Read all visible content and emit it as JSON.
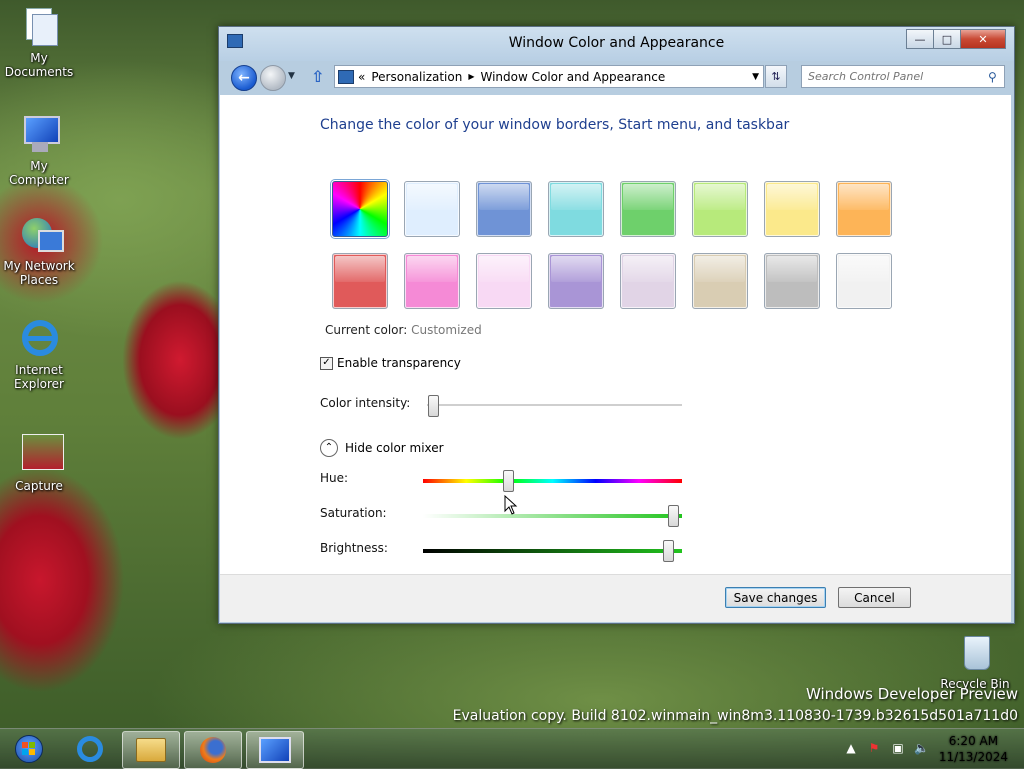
{
  "desktop": {
    "icons": [
      {
        "label": "My Documents"
      },
      {
        "label": "My Computer"
      },
      {
        "label": "My Network Places"
      },
      {
        "label": "Internet Explorer"
      },
      {
        "label": "Capture"
      },
      {
        "label": "Recycle Bin"
      }
    ],
    "watermark_line1": "Windows Developer Preview",
    "watermark_line2": "Evaluation copy. Build 8102.winmain_win8m3.110830-1739.b32615d501a711d0"
  },
  "window": {
    "title": "Window Color and Appearance",
    "caption_buttons": {
      "minimize": "—",
      "maximize": "□",
      "close": "✕"
    },
    "breadcrumb": [
      "Personalization",
      "Window Color and Appearance"
    ],
    "breadcrumb_prefix": "«",
    "search_placeholder": "Search Control Panel",
    "heading": "Change the color of your window borders, Start menu, and taskbar",
    "swatches": [
      {
        "name": "customized",
        "color": "rainbow"
      },
      {
        "name": "sky",
        "color": "#dfeefe"
      },
      {
        "name": "twilight",
        "color": "#6f93d6"
      },
      {
        "name": "sea",
        "color": "#7fdbe0"
      },
      {
        "name": "leaf",
        "color": "#6ed06b"
      },
      {
        "name": "lime",
        "color": "#b7ea7b"
      },
      {
        "name": "lemon",
        "color": "#fbe98b"
      },
      {
        "name": "pumpkin",
        "color": "#fdb457"
      },
      {
        "name": "ruby",
        "color": "#e05a5a"
      },
      {
        "name": "fuchsia",
        "color": "#f58ad6"
      },
      {
        "name": "blush",
        "color": "#f8d9f4"
      },
      {
        "name": "violet",
        "color": "#a995d6"
      },
      {
        "name": "lavender",
        "color": "#e1d4e6"
      },
      {
        "name": "taupe",
        "color": "#d9cdb3"
      },
      {
        "name": "chocolate",
        "color": "#bdbdbd"
      },
      {
        "name": "slate",
        "color": "#f1f1f1"
      }
    ],
    "current_color_label": "Current color:",
    "current_color_value": "Customized",
    "enable_transparency_label": "Enable transparency",
    "enable_transparency_checked": true,
    "color_intensity_label": "Color intensity:",
    "color_intensity_value": 0.02,
    "hide_mixer_label": "Hide color mixer",
    "hue_label": "Hue:",
    "hue_value": 0.32,
    "saturation_label": "Saturation:",
    "saturation_value": 0.98,
    "brightness_label": "Brightness:",
    "brightness_value": 0.96,
    "save_label": "Save changes",
    "cancel_label": "Cancel"
  },
  "taskbar": {
    "apps": [
      "internet-explorer",
      "windows-explorer",
      "firefox",
      "control-panel"
    ],
    "time": "6:20 AM",
    "date": "11/13/2024"
  },
  "colors": {
    "heading": "#1e3f8f",
    "hue_gradient": "red-yellow-green-cyan-blue-magenta-red",
    "mixer_green": "#22c41e"
  }
}
